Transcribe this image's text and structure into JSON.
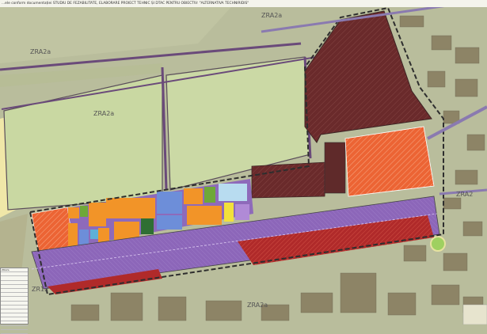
{
  "header": {
    "text": "...ele conform documentației STUDIU DE FEZABILITATE, ELABORARE PROIECT TEHNIC ȘI DTAC PENTRU OBIECTIV: \"ALTERNATIVA TECHNIRIDIS\""
  },
  "map": {
    "zone_labels": [
      {
        "id": "zra2a-top",
        "text": "ZRA2a"
      },
      {
        "id": "zra2a-left",
        "text": "ZRA2a"
      },
      {
        "id": "zra2a-mid",
        "text": "ZRA2a"
      },
      {
        "id": "zra2a-bottom",
        "text": "ZRA2a"
      },
      {
        "id": "zra2-right",
        "text": "ZRA2"
      },
      {
        "id": "zr12-left",
        "text": "ZR12"
      }
    ],
    "colors": {
      "background_field": "#b9bd9c",
      "industrial_dark": "#6b2b2b",
      "hatched_orange": "#e8592f",
      "orange_zone": "#f29428",
      "purple_corridor": "#8b63b8",
      "blue_zone": "#6d8ed9",
      "green_zone": "#6ea838",
      "light_green_field": "#c7d7a0",
      "boundary": "#3c3c3c"
    }
  },
  "legend": {
    "rows": [
      "ZRA2a",
      "",
      "",
      "",
      "",
      "",
      "",
      "",
      "",
      "",
      "",
      "",
      "",
      "",
      "",
      ""
    ]
  }
}
